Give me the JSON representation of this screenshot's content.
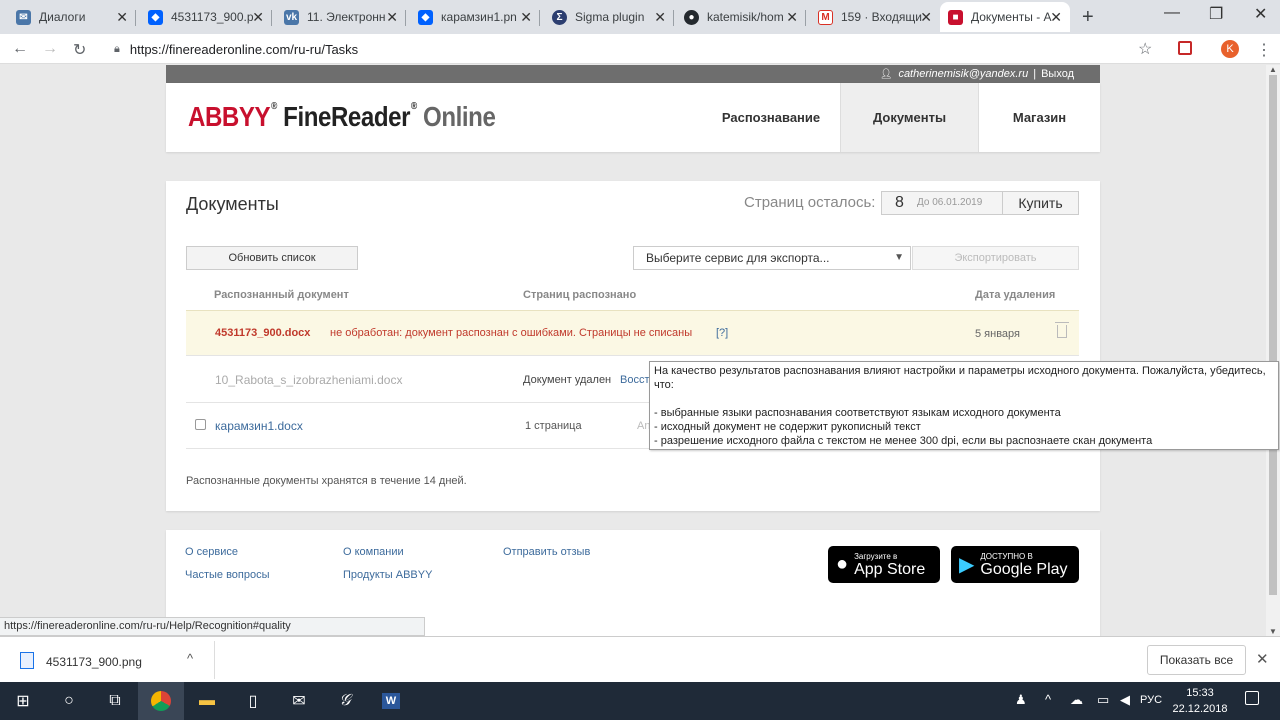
{
  "browser": {
    "tabs": [
      {
        "title": "Диалоги",
        "icon": "vk-messages-icon",
        "color": "#4a76a8"
      },
      {
        "title": "4531173_900.p",
        "icon": "dropbox-icon",
        "color": "#0061fe"
      },
      {
        "title": "11. Электронн",
        "icon": "vk-icon",
        "color": "#4a76a8"
      },
      {
        "title": "карамзин1.pn",
        "icon": "dropbox-icon",
        "color": "#0061fe"
      },
      {
        "title": "Sigma plugin",
        "icon": "sigma-icon",
        "color": "#2c3e70"
      },
      {
        "title": "katemisik/hom",
        "icon": "github-icon",
        "color": "#24292e"
      },
      {
        "title": "159 · Входящи",
        "icon": "gmail-icon",
        "color": "#d93025"
      },
      {
        "title": "Документы - А",
        "icon": "abbyy-icon",
        "color": "#c8102e"
      }
    ],
    "url": "https://finereaderonline.com/ru-ru/Tasks",
    "profile_initial": "K"
  },
  "topstrip": {
    "user": "catherinemisik@yandex.ru",
    "separator": "|",
    "logout": "Выход"
  },
  "header": {
    "logo": {
      "abbyy": "ABBYY",
      "finereader": "FineReader",
      "online": "Online"
    },
    "nav": [
      "Распознавание",
      "Документы",
      "Магазин"
    ]
  },
  "documents": {
    "title": "Документы",
    "pages_left_label": "Страниц осталось:",
    "pages_left_value": "8",
    "pages_until": "До 06.01.2019",
    "buy_label": "Купить",
    "refresh_label": "Обновить список",
    "export_placeholder": "Выберите сервис для экспорта...",
    "export_button": "Экспортировать",
    "columns": [
      "Распознанный документ",
      "Страниц распознано",
      "Дата удаления"
    ],
    "rows": [
      {
        "name": "4531173_900.docx",
        "message": "не обработан: документ распознан с ошибками. Страницы не списаны",
        "help": "[?]",
        "date": "5 января"
      },
      {
        "name": "10_Rabota_s_izobrazheniami.docx",
        "status": "Документ удален",
        "restore": "Восст"
      },
      {
        "name": "карамзин1.docx",
        "pages": "1 страница",
        "extra": "An"
      }
    ],
    "note": "Распознанные документы хранятся в течение 14 дней."
  },
  "tooltip": {
    "line1": "На качество результатов распознавания влияют настройки и параметры исходного документа. Пожалуйста, убедитесь,",
    "line2": "что:",
    "items": [
      "- выбранные языки распознавания соответствуют языкам исходного документа",
      "- исходный документ не содержит рукописный текст",
      "- разрешение исходного файла с текстом не менее 300 dpi, если вы распознаете скан документа"
    ]
  },
  "footer": {
    "links": [
      "О сервисе",
      "О компании",
      "Отправить отзыв",
      "Частые вопросы",
      "Продукты ABBYY"
    ],
    "appstore": {
      "small": "Загрузите в",
      "big": "App Store"
    },
    "googleplay": {
      "small": "ДОСТУПНО В",
      "big": "Google Play"
    }
  },
  "status_url": "https://finereaderonline.com/ru-ru/Help/Recognition#quality",
  "download": {
    "file": "4531173_900.png",
    "show_all": "Показать все"
  },
  "taskbar": {
    "lang": "РУС",
    "time": "15:33",
    "date": "22.12.2018"
  }
}
